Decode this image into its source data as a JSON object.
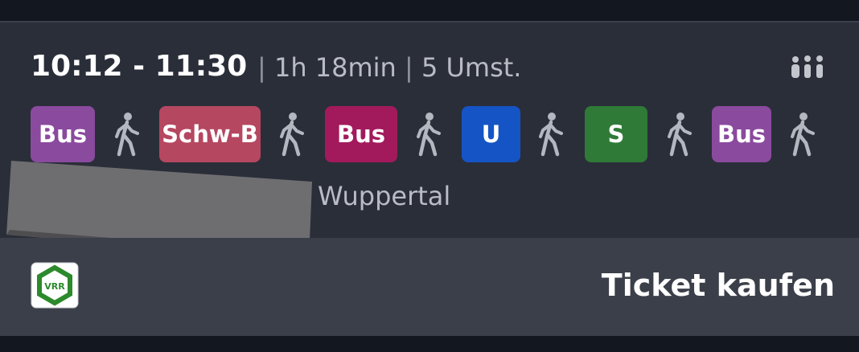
{
  "connection": {
    "times": "10:12 - 11:30",
    "duration": "1h 18min",
    "transfers": "5 Umst.",
    "separator": "|",
    "occupancy_icon": "occupancy-people-icon"
  },
  "legs": [
    {
      "type": "chip",
      "label": "Bus",
      "color": "#8a4a9e"
    },
    {
      "type": "walk",
      "icon": "walking-person-icon"
    },
    {
      "type": "chip",
      "label": "Schw-B",
      "color": "#b54760"
    },
    {
      "type": "walk",
      "icon": "walking-person-icon"
    },
    {
      "type": "chip",
      "label": "Bus",
      "color": "#a21a5c"
    },
    {
      "type": "walk",
      "icon": "walking-person-icon"
    },
    {
      "type": "chip",
      "label": "U",
      "color": "#1554c4"
    },
    {
      "type": "walk",
      "icon": "walking-person-icon"
    },
    {
      "type": "chip",
      "label": "S",
      "color": "#2f7a37"
    },
    {
      "type": "walk",
      "icon": "walking-person-icon"
    },
    {
      "type": "chip",
      "label": "Bus",
      "color": "#8a4a9e"
    },
    {
      "type": "walk",
      "icon": "walking-person-icon"
    }
  ],
  "destination": "Wuppertal",
  "footer": {
    "logo_text": "VRR",
    "logo_color": "#2c8a2c",
    "ticket_label": "Ticket kaufen"
  },
  "colors": {
    "card_background": "#2a2e39",
    "footer_background": "#3b3f49",
    "text_primary": "#ffffff",
    "text_secondary": "#b9bcc4",
    "walk_icon": "#b3b7bf"
  }
}
